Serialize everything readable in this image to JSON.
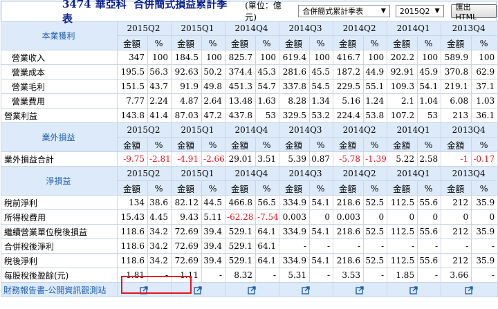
{
  "title": {
    "code": "3474",
    "company": "華亞科",
    "report": "合併簡式損益累計季表",
    "unit": "(單位：億元)"
  },
  "controls": {
    "report_select": "合併簡式累計季表",
    "period_select": "2015Q2",
    "export_button": "匯出HTML",
    "dropdown_icon": "caret-down"
  },
  "periods": [
    "2015Q2",
    "2015Q1",
    "2014Q4",
    "2014Q3",
    "2014Q2",
    "2014Q1",
    "2013Q4"
  ],
  "col_headers": {
    "amount": "金額",
    "pct": "%"
  },
  "sections": [
    {
      "title": "本業獲利",
      "rows": [
        {
          "label": "營業收入",
          "indent": true,
          "values": [
            "347",
            "100",
            "184.5",
            "100",
            "825.7",
            "100",
            "619.4",
            "100",
            "416.7",
            "100",
            "202.2",
            "100",
            "589.9",
            "100"
          ]
        },
        {
          "label": "營業成本",
          "indent": true,
          "values": [
            "195.5",
            "56.3",
            "92.63",
            "50.2",
            "374.4",
            "45.3",
            "281.6",
            "45.5",
            "187.2",
            "44.9",
            "92.91",
            "45.9",
            "370.8",
            "62.9"
          ]
        },
        {
          "label": "營業毛利",
          "indent": true,
          "values": [
            "151.5",
            "43.7",
            "91.9",
            "49.8",
            "451.3",
            "54.7",
            "337.8",
            "54.5",
            "229.5",
            "55.1",
            "109.3",
            "54.1",
            "219.1",
            "37.1"
          ]
        },
        {
          "label": "營業費用",
          "indent": true,
          "values": [
            "7.77",
            "2.24",
            "4.87",
            "2.64",
            "13.48",
            "1.63",
            "8.28",
            "1.34",
            "5.16",
            "1.24",
            "2.1",
            "1.04",
            "6.08",
            "1.03"
          ]
        },
        {
          "label": "營業利益",
          "indent": false,
          "values": [
            "143.8",
            "41.4",
            "87.03",
            "47.2",
            "437.8",
            "53",
            "329.5",
            "53.2",
            "224.4",
            "53.8",
            "107.2",
            "53",
            "213",
            "36.1"
          ]
        }
      ]
    },
    {
      "title": "業外損益",
      "rows": [
        {
          "label": "業外損益合計",
          "indent": false,
          "values": [
            "-9.75",
            "-2.81",
            "-4.91",
            "-2.66",
            "29.01",
            "3.51",
            "5.39",
            "0.87",
            "-5.78",
            "-1.39",
            "5.22",
            "2.58",
            "-1",
            "-0.17"
          ]
        }
      ]
    },
    {
      "title": "淨損益",
      "rows": [
        {
          "label": "稅前淨利",
          "indent": false,
          "values": [
            "134",
            "38.6",
            "82.12",
            "44.5",
            "466.8",
            "56.5",
            "334.9",
            "54.1",
            "218.6",
            "52.5",
            "112.5",
            "55.6",
            "212",
            "35.9"
          ]
        },
        {
          "label": "所得稅費用",
          "indent": false,
          "values": [
            "15.43",
            "4.45",
            "9.43",
            "5.11",
            "-62.28",
            "-7.54",
            "0.003",
            "0",
            "0.003",
            "0",
            "0",
            "0",
            "0",
            "0"
          ]
        },
        {
          "label": "繼續營業單位稅後損益",
          "indent": false,
          "values": [
            "118.6",
            "34.2",
            "72.69",
            "39.4",
            "529.1",
            "64.1",
            "334.9",
            "54.1",
            "218.6",
            "52.5",
            "112.5",
            "55.6",
            "212",
            "35.9"
          ]
        },
        {
          "label": "合併稅後淨利",
          "indent": false,
          "values": [
            "118.6",
            "34.2",
            "72.69",
            "39.4",
            "529.1",
            "64.1",
            "-",
            "-",
            "-",
            "-",
            "-",
            "-",
            "-",
            "-"
          ]
        },
        {
          "label": "稅後淨利",
          "indent": false,
          "values": [
            "118.6",
            "34.2",
            "72.69",
            "39.4",
            "529.1",
            "64.1",
            "334.9",
            "54.1",
            "218.6",
            "52.5",
            "112.5",
            "55.6",
            "212",
            "35.9"
          ]
        },
        {
          "label": "每股稅後盈餘(元)",
          "indent": false,
          "values": [
            "1.81",
            "-",
            "1.11",
            "-",
            "8.32",
            "-",
            "5.31",
            "-",
            "3.53",
            "-",
            "1.85",
            "-",
            "3.66",
            "-"
          ]
        }
      ]
    }
  ],
  "footer": {
    "label": "財務報告書-公開資訊觀測站",
    "icon": "external-link-icon"
  },
  "colors": {
    "header_bg": "#ddeaf9",
    "section_text": "#1f5fb0",
    "title_text": "#0a1f8f",
    "negative": "#e8141e",
    "highlight": "#e8141e"
  }
}
